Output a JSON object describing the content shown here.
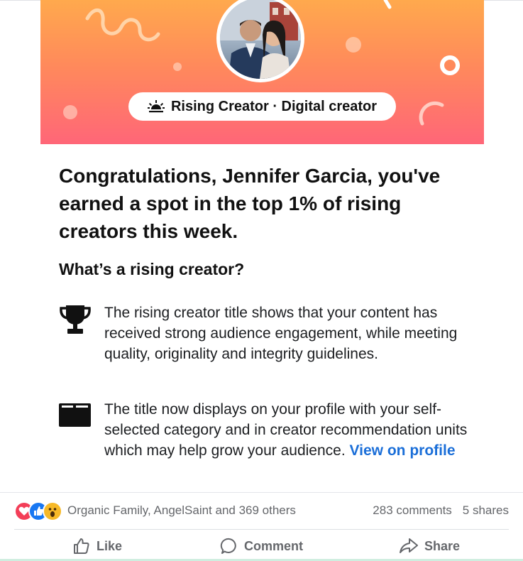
{
  "banner": {
    "title_badge": "Rising Creator · Digital creator",
    "badge_icon": "sunrise-icon",
    "avatar": "profile-photo"
  },
  "headline": "Congratulations, Jennifer Garcia, you've earned a spot in the top 1% of rising creators this week.",
  "subheading": "What’s a rising creator?",
  "features": [
    {
      "icon": "trophy-icon",
      "text": "The rising creator title shows that your content has received strong audience engagement, while meeting quality, originality and integrity guidelines."
    },
    {
      "icon": "profile-card-icon",
      "text": "The title now displays on your profile with your self-selected category and in creator recommendation units which may help grow your audience.",
      "link_label": "View on profile"
    }
  ],
  "engagement": {
    "reaction_icons": [
      "love-icon",
      "like-icon",
      "wow-icon"
    ],
    "reacted_by": "Organic Family, AngelSaint and 369 others",
    "comments": "283 comments",
    "shares": "5 shares"
  },
  "actions": {
    "like": "Like",
    "comment": "Comment",
    "share": "Share"
  },
  "colors": {
    "banner_top": "#ffa94d",
    "banner_bottom": "#ff6678",
    "link": "#1a6ed8",
    "muted_text": "#65676b"
  }
}
